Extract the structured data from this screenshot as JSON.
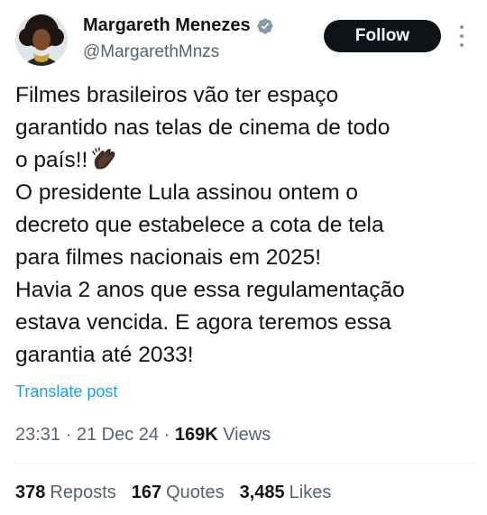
{
  "author": {
    "name": "Margareth Menezes",
    "handle": "@MargarethMnzs",
    "verified_color": "#829aab"
  },
  "follow_button": {
    "label": "Follow"
  },
  "tweet": {
    "lines": [
      "Filmes brasileiros vão ter espaço",
      "garantido nas telas de cinema de todo",
      "o país!!",
      "O presidente Lula assinou ontem o",
      "decreto que estabelece a cota de tela",
      "para filmes nacionais em 2025!",
      "Havia 2 anos que essa regulamentação",
      "estava vencida. E agora teremos essa",
      "garantia até 2033!"
    ],
    "emoji": "clapping-hands-icon"
  },
  "translate_label": "Translate post",
  "meta": {
    "time": "23:31",
    "separator": "·",
    "date": "21 Dec 24",
    "views_count": "169K",
    "views_label": "Views"
  },
  "stats": {
    "reposts_count": "378",
    "reposts_label": "Reposts",
    "quotes_count": "167",
    "quotes_label": "Quotes",
    "likes_count": "3,485",
    "likes_label": "Likes"
  },
  "colors": {
    "text": "#0f1419",
    "secondary": "#536471",
    "link": "#1d9bf0",
    "button_bg": "#0f1419"
  }
}
